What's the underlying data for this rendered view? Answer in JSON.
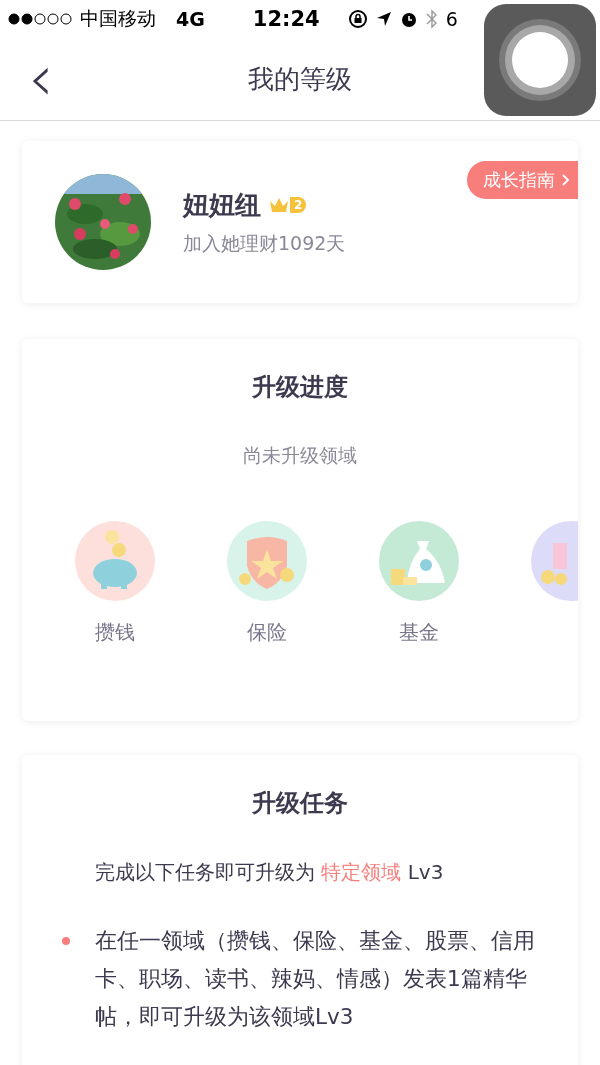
{
  "status_bar": {
    "carrier": "中国移动",
    "network": "4G",
    "time": "12:24",
    "battery": "6"
  },
  "nav": {
    "back": "‹",
    "title": "我的等级"
  },
  "profile": {
    "name": "妞妞纽",
    "level_badge": "2",
    "joined": "加入她理财1092天",
    "guide_button": "成长指南"
  },
  "progress": {
    "title": "升级进度",
    "subtitle": "尚未升级领域",
    "domains": [
      {
        "label": "攒钱",
        "kind": "piggy",
        "color": "#fde0dc"
      },
      {
        "label": "保险",
        "kind": "shield",
        "color": "#d7f3ea"
      },
      {
        "label": "基金",
        "kind": "bag",
        "color": "#c4ead6"
      },
      {
        "kind": "stock",
        "color": "#dcdcf8"
      }
    ]
  },
  "tasks": {
    "title": "升级任务",
    "intro_parts": [
      "完成以下任务即可升级为 ",
      "特定领域",
      " Lv3"
    ],
    "items": [
      "在任一领域（攒钱、保险、基金、股票、信用卡、职场、读书、辣妈、情感）发表1篇精华帖，即可升级为该领域Lv3"
    ]
  }
}
